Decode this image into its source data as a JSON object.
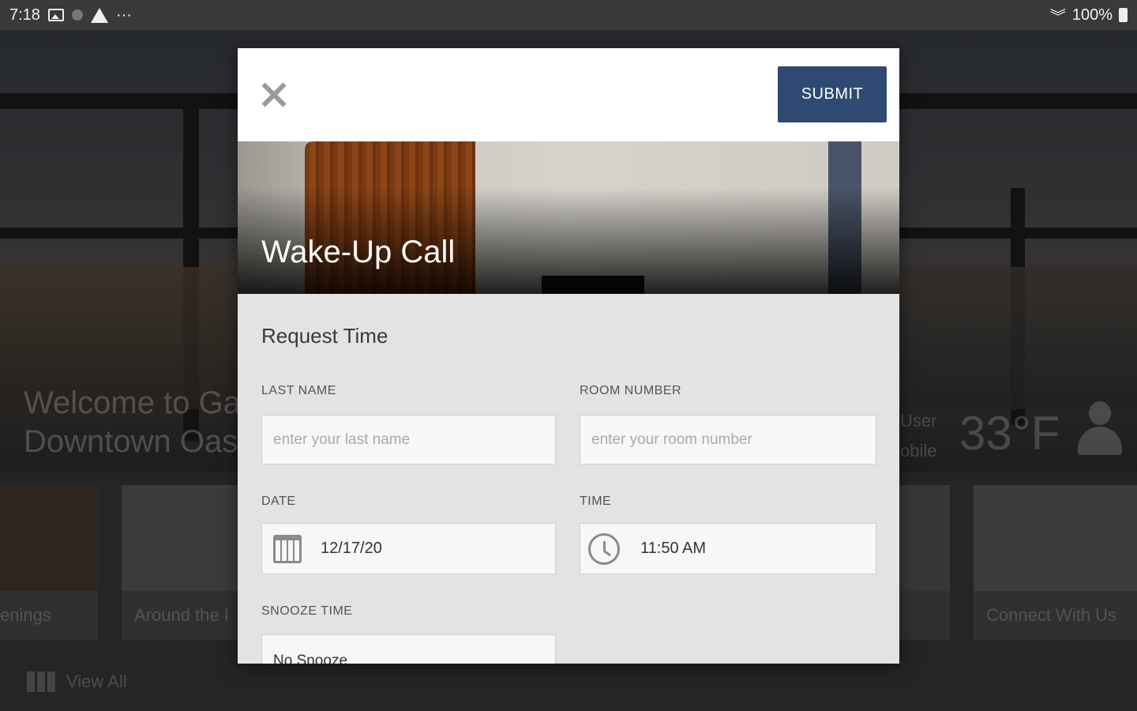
{
  "status_bar": {
    "time": "7:18",
    "battery": "100%"
  },
  "background": {
    "welcome_line1": "Welcome to Ga",
    "welcome_line2": "Downtown Oas",
    "user_line1": "User",
    "user_line2": "obile",
    "temperature": "33°F",
    "cards": [
      "enings",
      "Around the I",
      "",
      "Connect With Us"
    ],
    "view_all": "View All"
  },
  "modal": {
    "submit_label": "SUBMIT",
    "title": "Wake-Up Call",
    "section_heading": "Request Time",
    "fields": {
      "last_name": {
        "label": "LAST NAME",
        "placeholder": "enter your last name",
        "value": ""
      },
      "room_number": {
        "label": "ROOM NUMBER",
        "placeholder": "enter your room number",
        "value": ""
      },
      "date": {
        "label": "DATE",
        "value": "12/17/20"
      },
      "time": {
        "label": "TIME",
        "value": "11:50 AM"
      },
      "snooze_time": {
        "label": "SNOOZE TIME",
        "value": "No Snooze"
      }
    }
  },
  "colors": {
    "submit_bg": "#2e4a72",
    "form_bg": "#e3e3e3"
  }
}
